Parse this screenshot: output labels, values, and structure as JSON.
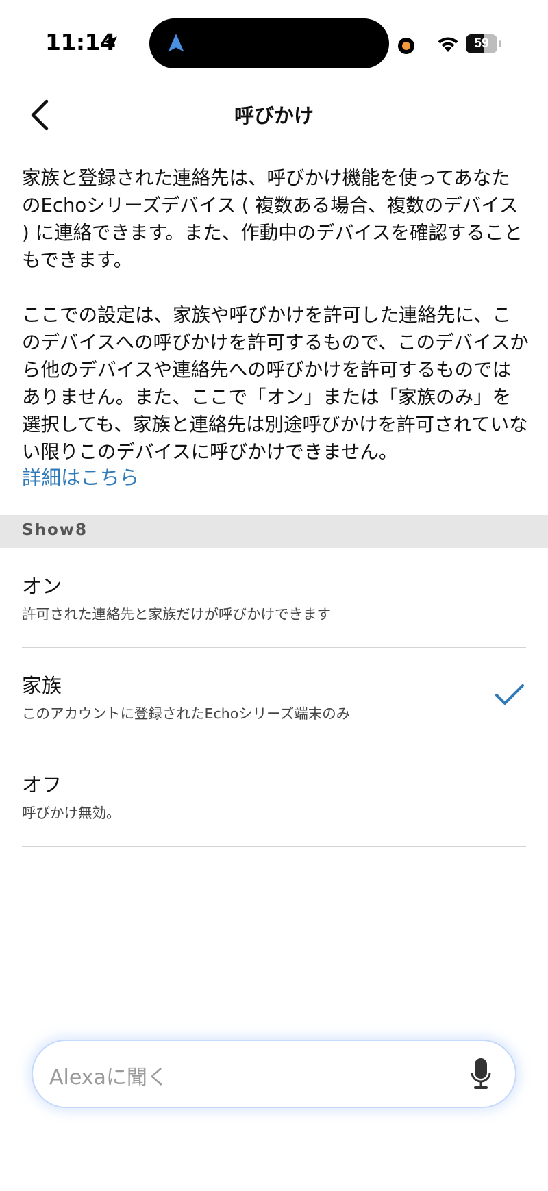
{
  "status_bar": {
    "time": "11:14",
    "battery_level": "59",
    "battery_percent": 59,
    "icons": [
      "location-arrow-icon",
      "navigation-arrow-icon",
      "camera-indicator-icon",
      "wifi-icon",
      "battery-icon"
    ],
    "accent_colors": {
      "navigation_arrow": "#4a90e2",
      "camera_indicator": "#f29a3c"
    }
  },
  "header": {
    "back_icon": "chevron-left-icon",
    "title": "呼びかけ"
  },
  "description": {
    "paragraph_1": "家族と登録された連絡先は、呼びかけ機能を使ってあなたのEchoシリーズデバイス ( 複数ある場合、複数のデバイス ) に連絡できます。また、作動中のデバイスを確認することもできます。",
    "paragraph_2": "ここでの設定は、家族や呼びかけを許可した連絡先に、このデバイスへの呼びかけを許可するもので、このデバイスから他のデバイスや連絡先への呼びかけを許可するものではありません。また、ここで「オン」または「家族のみ」を選択しても、家族と連絡先は別途呼びかけを許可されていない限りこのデバイスに呼びかけできません。",
    "learn_more": "詳細はこちら"
  },
  "section": {
    "device_name": "Show8"
  },
  "options": [
    {
      "title": "オン",
      "subtitle": "許可された連絡先と家族だけが呼びかけできます",
      "selected": false
    },
    {
      "title": "家族",
      "subtitle": "このアカウントに登録されたEchoシリーズ端末のみ",
      "selected": true
    },
    {
      "title": "オフ",
      "subtitle": "呼びかけ無効。",
      "selected": false
    }
  ],
  "alexa_bar": {
    "placeholder": "Alexaに聞く",
    "mic_icon": "microphone-icon"
  },
  "colors": {
    "link": "#2f7ab8",
    "check": "#2f7ab8",
    "section_background": "#e6e6e6"
  }
}
